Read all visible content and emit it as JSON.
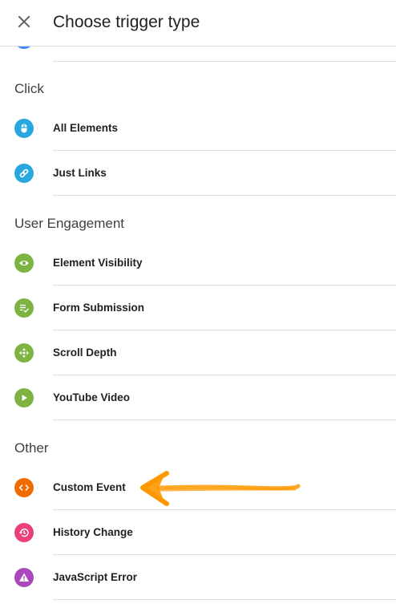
{
  "header": {
    "title": "Choose trigger type",
    "close_icon": "close-icon"
  },
  "sections": [
    {
      "title": "Click",
      "items": [
        {
          "label": "All Elements",
          "icon": "mouse-icon",
          "color": "#29a8e0"
        },
        {
          "label": "Just Links",
          "icon": "link-icon",
          "color": "#29a8e0"
        }
      ]
    },
    {
      "title": "User Engagement",
      "items": [
        {
          "label": "Element Visibility",
          "icon": "eye-icon",
          "color": "#7cb342"
        },
        {
          "label": "Form Submission",
          "icon": "form-check-icon",
          "color": "#7cb342"
        },
        {
          "label": "Scroll Depth",
          "icon": "scroll-arrows-icon",
          "color": "#7cb342"
        },
        {
          "label": "YouTube Video",
          "icon": "play-icon",
          "color": "#7cb342"
        }
      ]
    },
    {
      "title": "Other",
      "items": [
        {
          "label": "Custom Event",
          "icon": "code-icon",
          "color": "#ef6c00"
        },
        {
          "label": "History Change",
          "icon": "history-icon",
          "color": "#ec407a"
        },
        {
          "label": "JavaScript Error",
          "icon": "warning-icon",
          "color": "#ab47bc"
        }
      ]
    }
  ],
  "colors": {
    "annotation_arrow": "#ff9800",
    "partial_item_icon": "#4285f4"
  }
}
